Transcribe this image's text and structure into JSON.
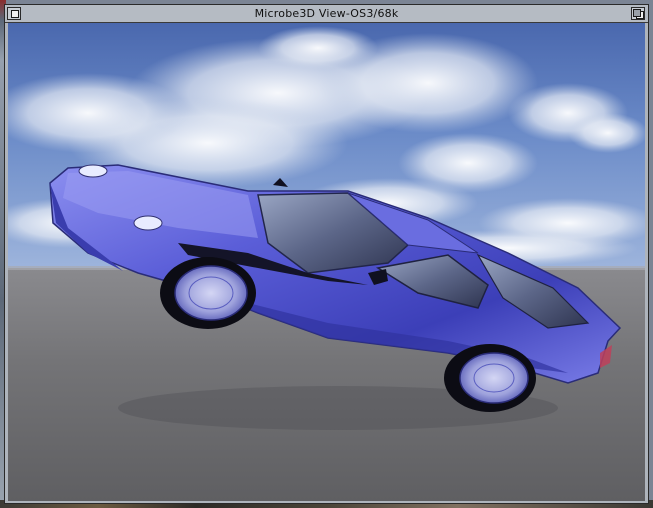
{
  "window": {
    "title": "Microbe3D View-OS3/68k"
  },
  "icons": {
    "close": "close-gadget-icon",
    "depth": "depth-gadget-icon"
  },
  "colors": {
    "car_body": "#5c5fd6",
    "sky_top": "#3d5ea8",
    "ground": "#707073",
    "titlebar": "#b5bbc3"
  }
}
